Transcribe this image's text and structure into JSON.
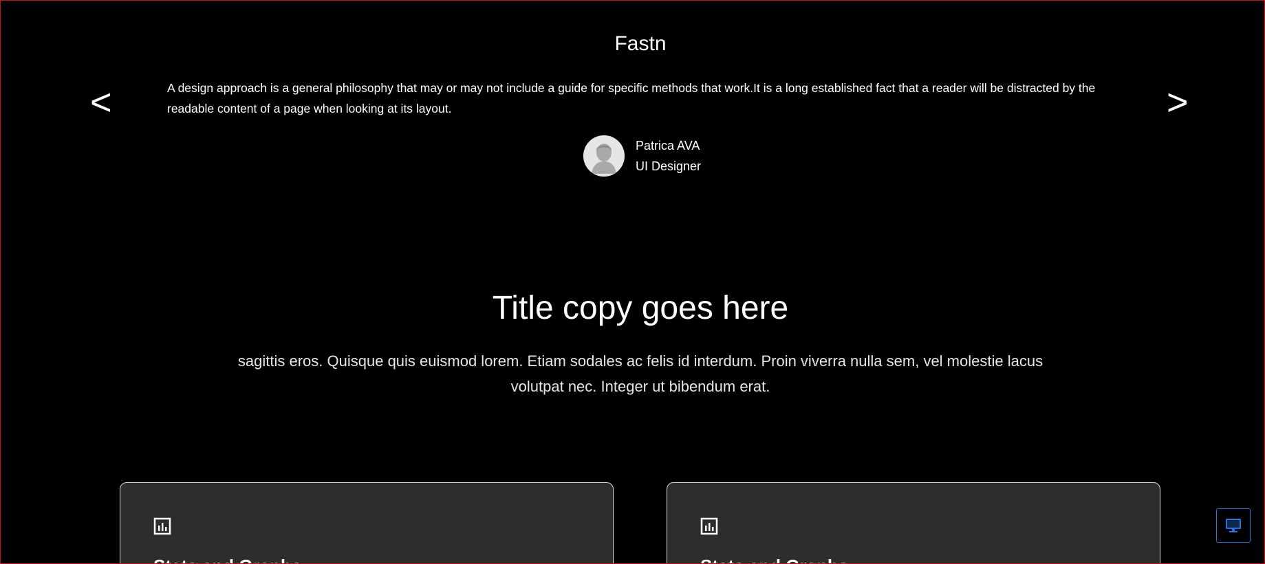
{
  "testimonial": {
    "brand": "Fastn",
    "prev_label": "<",
    "next_label": ">",
    "quote": "A design approach is a general philosophy that may or may not include a guide for specific methods that work.It is a long established fact that a reader will be distracted by the readable content of a page when looking at its layout.",
    "author_name": "Patrica AVA",
    "author_role": "UI Designer"
  },
  "feature": {
    "title": "Title copy goes here",
    "description": "sagittis eros. Quisque quis euismod lorem. Etiam sodales ac felis id interdum. Proin viverra nulla sem, vel molestie lacus volutpat nec. Integer ut bibendum erat."
  },
  "cards": [
    {
      "icon": "bar-chart-icon",
      "title": "Stats and Graphs"
    },
    {
      "icon": "bar-chart-icon",
      "title": "Stats and Graphs"
    }
  ],
  "colors": {
    "background": "#000000",
    "card_background": "#2d2d2d",
    "frame_border": "#c1121f",
    "device_button_border": "#2f6fe0"
  },
  "device_toggle": {
    "icon": "desktop-monitor-icon"
  }
}
